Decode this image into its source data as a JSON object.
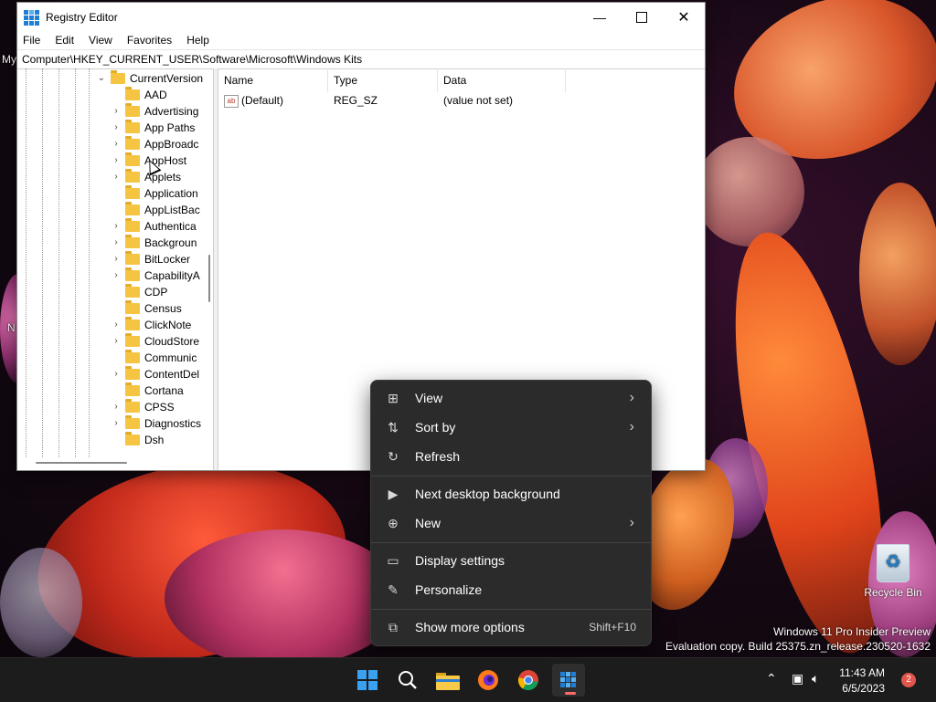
{
  "desktop": {
    "left_edge_fragments": [
      "My",
      "N"
    ],
    "recycle_bin_label": "Recycle Bin",
    "watermark": {
      "line1": "Windows 11 Pro Insider Preview",
      "line2": "Evaluation copy. Build 25375.zn_release.230520-1632"
    }
  },
  "regedit": {
    "title": "Registry Editor",
    "icon": "regedit-icon",
    "menu": [
      "File",
      "Edit",
      "View",
      "Favorites",
      "Help"
    ],
    "address": "Computer\\HKEY_CURRENT_USER\\Software\\Microsoft\\Windows Kits",
    "tree": {
      "parent": {
        "label": "CurrentVersion",
        "expanded": true
      },
      "children": [
        {
          "label": "AAD",
          "expandable": false
        },
        {
          "label": "Advertising",
          "expandable": true
        },
        {
          "label": "App Paths",
          "expandable": true
        },
        {
          "label": "AppBroadc",
          "expandable": true
        },
        {
          "label": "AppHost",
          "expandable": true
        },
        {
          "label": "Applets",
          "expandable": true
        },
        {
          "label": "Application",
          "expandable": false
        },
        {
          "label": "AppListBac",
          "expandable": false
        },
        {
          "label": "Authentica",
          "expandable": true
        },
        {
          "label": "Backgroun",
          "expandable": true
        },
        {
          "label": "BitLocker",
          "expandable": true
        },
        {
          "label": "CapabilityA",
          "expandable": true
        },
        {
          "label": "CDP",
          "expandable": false
        },
        {
          "label": "Census",
          "expandable": false
        },
        {
          "label": "ClickNote",
          "expandable": true
        },
        {
          "label": "CloudStore",
          "expandable": true
        },
        {
          "label": "Communic",
          "expandable": false
        },
        {
          "label": "ContentDel",
          "expandable": true
        },
        {
          "label": "Cortana",
          "expandable": false
        },
        {
          "label": "CPSS",
          "expandable": true
        },
        {
          "label": "Diagnostics",
          "expandable": true
        },
        {
          "label": "Dsh",
          "expandable": false
        }
      ]
    },
    "values": {
      "columns": [
        "Name",
        "Type",
        "Data"
      ],
      "rows": [
        {
          "name": "(Default)",
          "type": "REG_SZ",
          "data": "(value not set)",
          "icon": "ab"
        }
      ]
    }
  },
  "context_menu": {
    "groups": [
      [
        {
          "label": "View",
          "icon": "grid-icon",
          "submenu": true
        },
        {
          "label": "Sort by",
          "icon": "sort-icon",
          "submenu": true
        },
        {
          "label": "Refresh",
          "icon": "refresh-icon",
          "submenu": false
        }
      ],
      [
        {
          "label": "Next desktop background",
          "icon": "next-background-icon",
          "submenu": false
        },
        {
          "label": "New",
          "icon": "plus-circle-icon",
          "submenu": true
        }
      ],
      [
        {
          "label": "Display settings",
          "icon": "display-icon",
          "submenu": false
        },
        {
          "label": "Personalize",
          "icon": "pen-icon",
          "submenu": false
        }
      ],
      [
        {
          "label": "Show more options",
          "icon": "open-external-icon",
          "submenu": false,
          "shortcut": "Shift+F10"
        }
      ]
    ]
  },
  "taskbar": {
    "apps": [
      {
        "name": "start-button",
        "icon": "windows-logo-icon"
      },
      {
        "name": "search-button",
        "icon": "search-icon"
      },
      {
        "name": "file-explorer",
        "icon": "folder-icon"
      },
      {
        "name": "firefox",
        "icon": "firefox-icon"
      },
      {
        "name": "chrome",
        "icon": "chrome-icon"
      },
      {
        "name": "registry-editor",
        "icon": "regedit-icon",
        "active": true
      }
    ],
    "clock": {
      "time": "11:43 AM",
      "date": "6/5/2023"
    },
    "notification_count": "2"
  },
  "colors": {
    "menu_bg": "#2b2b2b",
    "taskbar_bg": "#1c1c1c",
    "folder": "#f5c542",
    "active_indicator": "#ff6b6b",
    "notification_badge": "#e0564c"
  }
}
